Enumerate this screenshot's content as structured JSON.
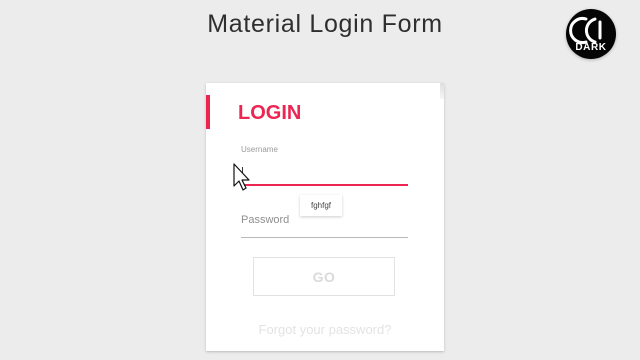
{
  "page": {
    "title": "Material Login Form"
  },
  "logo": {
    "name": "cc-dark-logo",
    "text": "DARK"
  },
  "login_card": {
    "title": "LOGIN",
    "accent_color": "#ed2553",
    "username": {
      "label": "Username",
      "value": ""
    },
    "autocomplete_suggestion": "fghfgf",
    "password": {
      "label": "Password",
      "value": ""
    },
    "submit_label": "GO",
    "forgot_label": "Forgot your password?"
  },
  "cursor": {
    "icon": "arrow-cursor-icon"
  }
}
